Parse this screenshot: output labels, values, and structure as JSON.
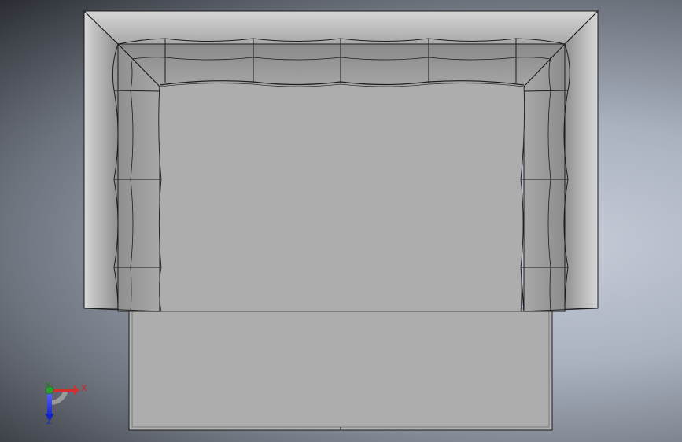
{
  "viewport": {
    "background_colors": [
      "#2a2d33",
      "#6e747e",
      "#aab2c0",
      "#c7ccd8"
    ]
  },
  "model": {
    "colors": {
      "seat": "#aeaeae",
      "footrest": "#b2b2b2",
      "arm_outer": "#c9c9c9",
      "cushion_light": "#9c9c9c",
      "cushion_dark": "#7d7d7d",
      "edge": "#1c1c1c"
    }
  },
  "triad": {
    "x_label": "X",
    "y_label": "Y",
    "z_label": "Z",
    "colors": {
      "x": "#d32f2f",
      "y": "#2e9e2e",
      "z": "#1f2fd0"
    }
  }
}
